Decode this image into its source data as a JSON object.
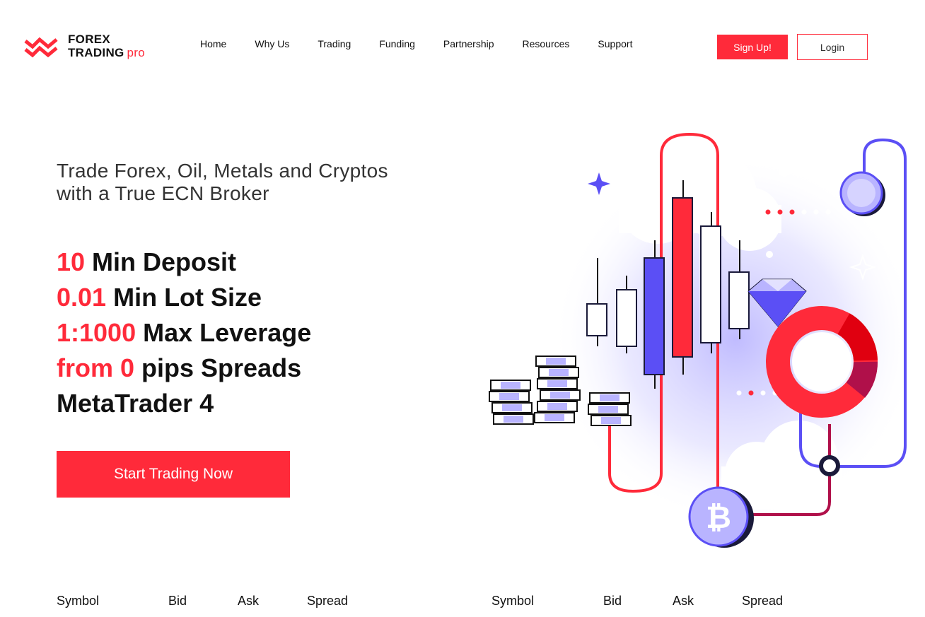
{
  "brand": {
    "line1": "FOREX",
    "line2": "TRADING",
    "suffix": "pro",
    "accent_color": "#ff2a3a",
    "secondary_color": "#5b4ff5"
  },
  "nav": {
    "items": [
      {
        "label": "Home"
      },
      {
        "label": "Why Us"
      },
      {
        "label": "Trading"
      },
      {
        "label": "Funding"
      },
      {
        "label": "Partnership"
      },
      {
        "label": "Resources"
      },
      {
        "label": "Support"
      }
    ],
    "signup_label": "Sign Up!",
    "login_label": "Login"
  },
  "hero": {
    "tagline_line1": "Trade Forex, Oil, Metals and Cryptos",
    "tagline_line2": "with a True ECN Broker",
    "features": [
      {
        "highlight": "10",
        "text": " Min Deposit"
      },
      {
        "highlight": "0.01",
        "text": " Min Lot Size"
      },
      {
        "highlight": "1:1000",
        "text": " Max Leverage"
      },
      {
        "highlight": "from 0",
        "text": " pips Spreads"
      },
      {
        "highlight": "",
        "text": "MetaTrader 4"
      }
    ],
    "cta_label": "Start Trading Now",
    "illustration_icons": [
      "candlestick-chart-icon",
      "coin-stacks-icon",
      "diamond-icon",
      "donut-chart-icon",
      "bitcoin-icon",
      "sparkle-icon"
    ]
  },
  "quotes_table": {
    "left": {
      "symbol": "Symbol",
      "bid": "Bid",
      "ask": "Ask",
      "spread": "Spread"
    },
    "right": {
      "symbol": "Symbol",
      "bid": "Bid",
      "ask": "Ask",
      "spread": "Spread"
    }
  }
}
